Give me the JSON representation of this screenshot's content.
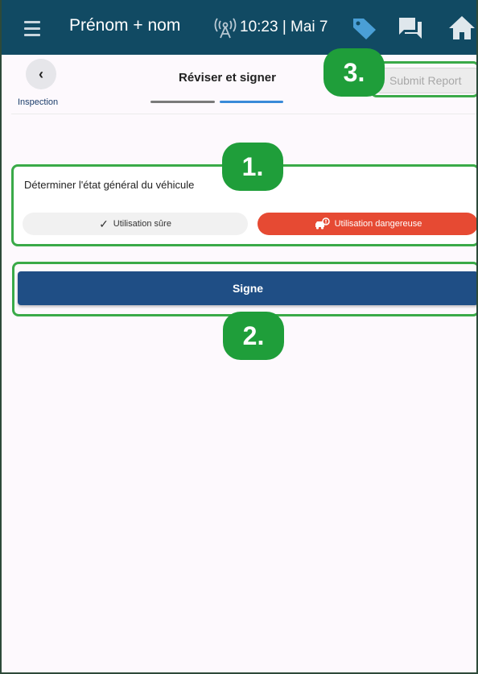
{
  "status_bar": {
    "user_name": "Prénom + nom",
    "time_date": "10:23 | Mai 7",
    "icons": [
      "menu-icon",
      "signal-icon",
      "tag-icon",
      "chat-icon",
      "home-icon"
    ]
  },
  "header": {
    "back_label": "Inspection",
    "title": "Réviser et signer",
    "submit_label": "Submit Report",
    "back_icon": "‹"
  },
  "condition_card": {
    "label": "Déterminer l'état général du véhicule",
    "safe_label": "Utilisation sûre",
    "unsafe_label": "Utilisation dangereuse"
  },
  "sign_button": {
    "label": "Signe"
  },
  "annotations": {
    "badge_1": "1.",
    "badge_2": "2.",
    "badge_3": "3."
  },
  "colors": {
    "topbar": "#114a63",
    "sign_button": "#1f4e85",
    "unsafe": "#e64a33",
    "annotation": "#3aaa48",
    "badge": "#1f9e3a"
  }
}
